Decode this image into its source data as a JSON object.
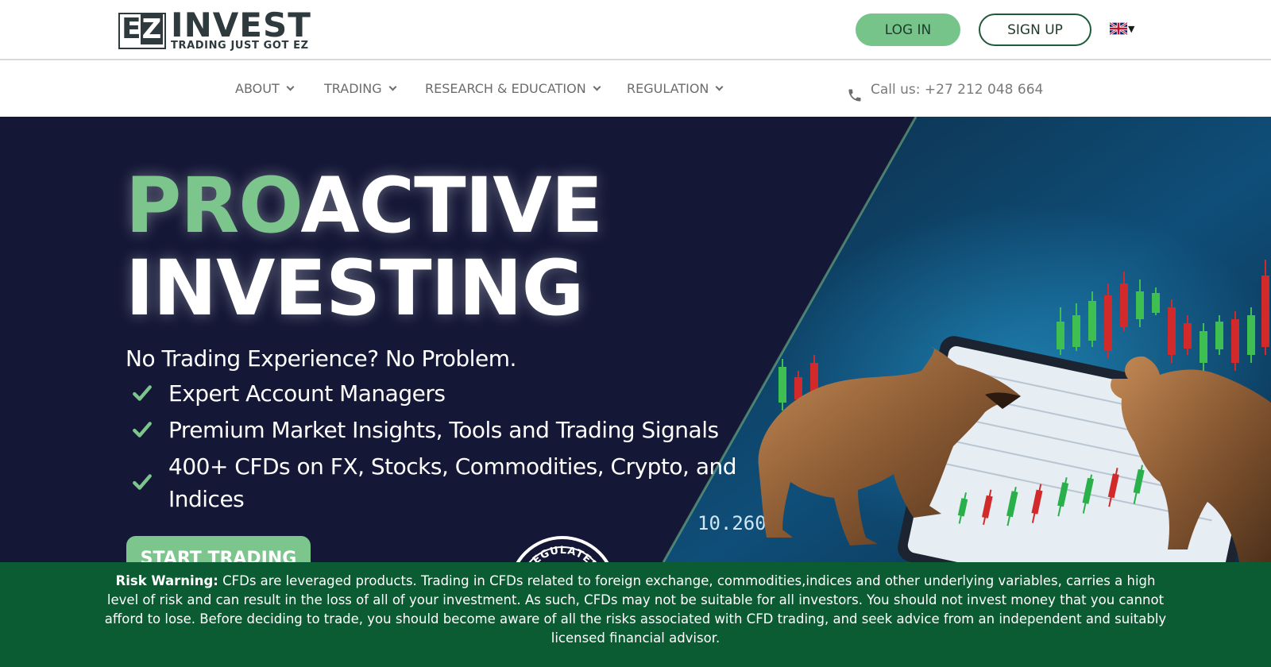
{
  "header": {
    "logo": {
      "mark": "EZ",
      "brand": "INVEST",
      "tagline": "TRADING JUST GOT EZ"
    },
    "login_label": "LOG IN",
    "signup_label": "SIGN UP",
    "language_icon": "uk-flag-icon"
  },
  "nav": {
    "items": [
      {
        "label": "ABOUT"
      },
      {
        "label": "TRADING"
      },
      {
        "label": "RESEARCH & EDUCATION"
      },
      {
        "label": "REGULATION"
      }
    ],
    "phone_icon": "phone-icon",
    "phone": "Call us: +27 212 048 664"
  },
  "hero": {
    "headline_accent": "PRO",
    "headline_rest": "ACTIVE",
    "headline_line2": "INVESTING",
    "subhead": "No Trading Experience? No Problem.",
    "features": [
      "Expert Account Managers",
      "Premium Market Insights, Tools and Trading Signals",
      "400+ CFDs on FX, Stocks, Commodities, Crypto, and Indices"
    ],
    "cta_label": "START TRADING",
    "badge_text": "REGULATED",
    "chart_readout": "10.260",
    "colors": {
      "accent": "#7cc58d",
      "background": "#141736"
    }
  },
  "risk_warning": {
    "label": "Risk Warning:",
    "text": "CFDs are leveraged products. Trading in CFDs related to foreign exchange, commodities,indices and other underlying variables, carries a high level of risk and can result in the loss of all of your investment. As such, CFDs may not be suitable for all investors. You should not invest money that you cannot afford to lose. Before deciding to trade, you should become aware of all the risks associated with CFD trading, and seek advice from an independent and suitably licensed financial advisor.",
    "background": "#0b5c32"
  }
}
